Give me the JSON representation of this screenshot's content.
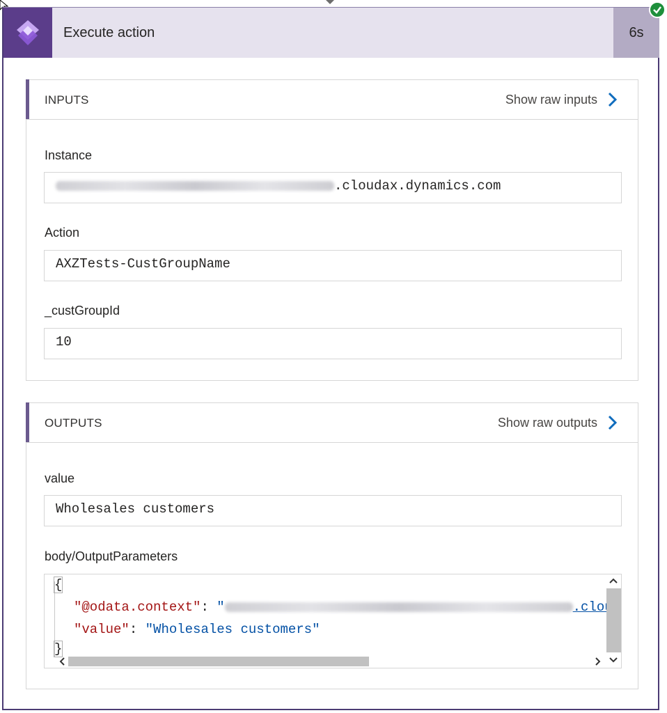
{
  "header": {
    "title": "Execute action",
    "duration": "6s"
  },
  "inputs": {
    "section_title": "INPUTS",
    "show_raw_label": "Show raw inputs",
    "fields": [
      {
        "label": "Instance",
        "value_suffix": ".cloudax.dynamics.com"
      },
      {
        "label": "Action",
        "value": "AXZTests-CustGroupName"
      },
      {
        "label": "_custGroupId",
        "value": "10"
      }
    ]
  },
  "outputs": {
    "section_title": "OUTPUTS",
    "show_raw_label": "Show raw outputs",
    "fields": [
      {
        "label": "value",
        "value": "Wholesales customers"
      },
      {
        "label": "body/OutputParameters"
      }
    ],
    "code": {
      "open_brace": "{",
      "close_brace": "}",
      "line1_key": "\"@odata.context\"",
      "line1_colon": ": ",
      "line1_value_prefix": "\"",
      "line1_value_suffix": ".clou",
      "line2_key": "\"value\"",
      "line2_colon": ": ",
      "line2_value": "\"Wholesales customers\""
    }
  },
  "colors": {
    "header_bg": "#e6e2ee",
    "logo_bg": "#5b3d8a",
    "accent": "#6b5a8e",
    "link_chevron": "#0f6cbd",
    "success": "#1e8f3b"
  },
  "icons": [
    "power-apps-logo-icon",
    "success-check-icon",
    "chevron-right-icon",
    "scroll-up-icon",
    "scroll-down-icon",
    "scroll-left-icon",
    "scroll-right-icon"
  ]
}
